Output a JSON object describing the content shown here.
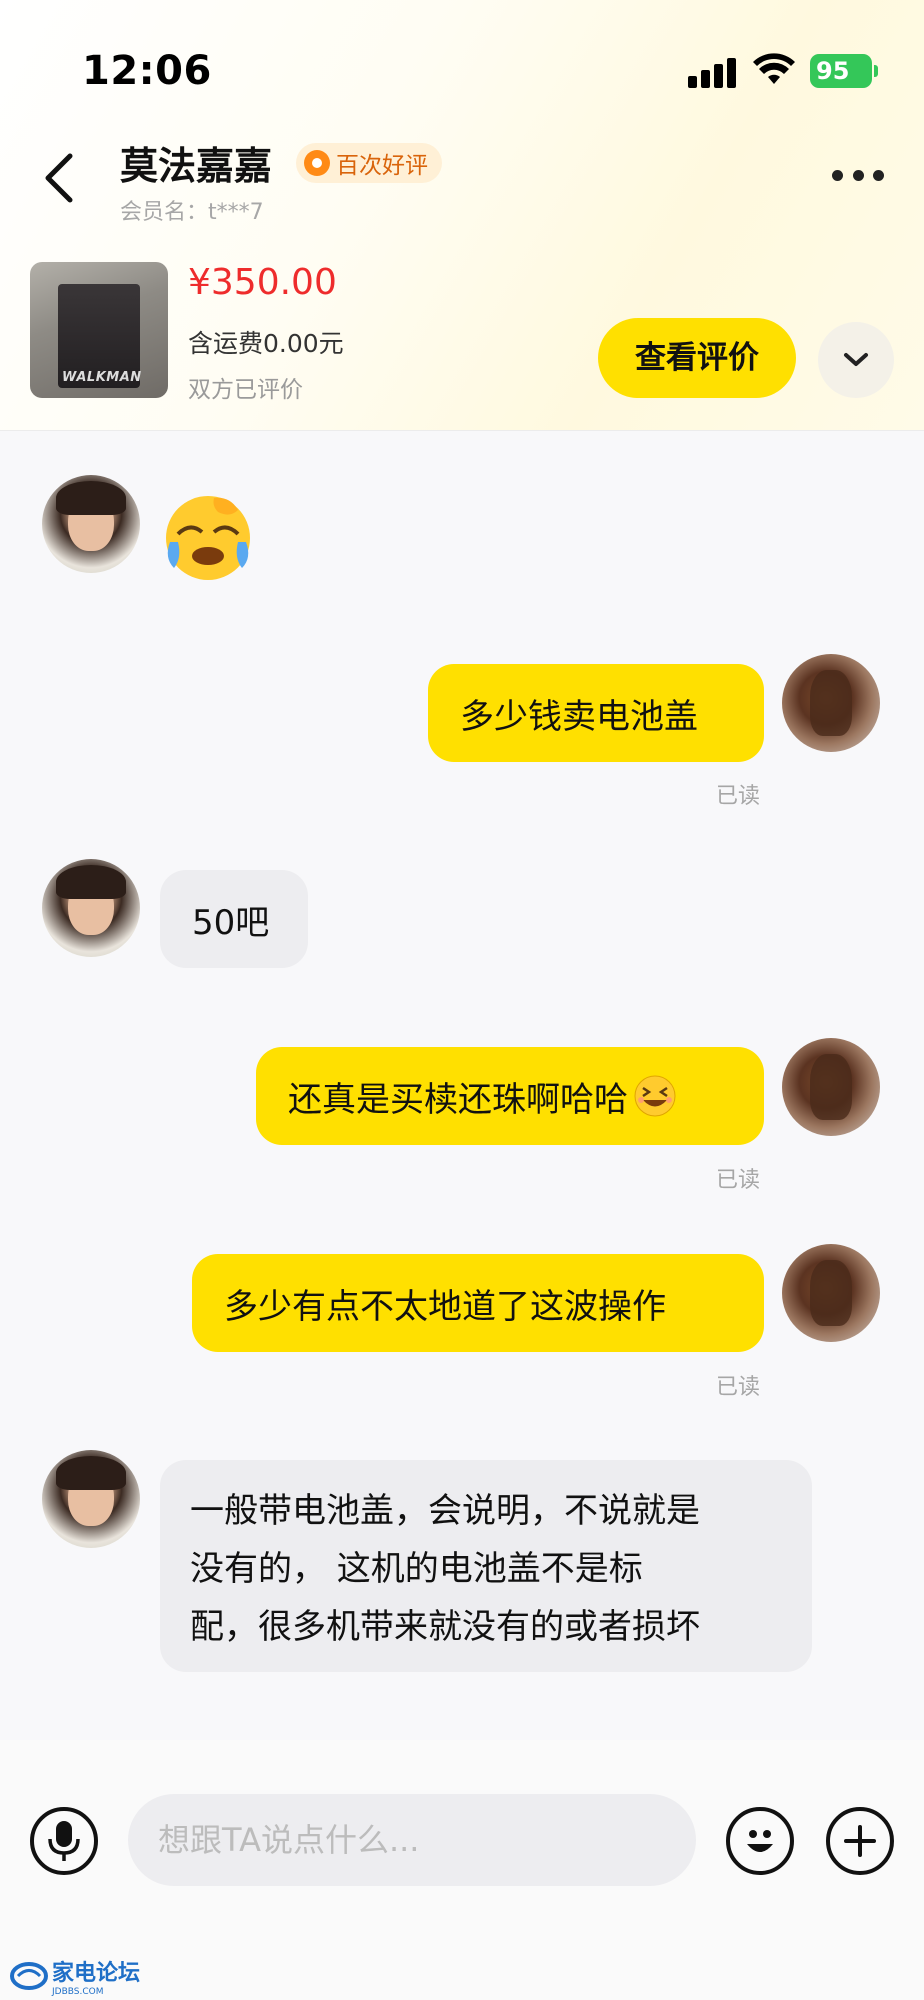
{
  "status_bar": {
    "time": "12:06",
    "battery": "95"
  },
  "nav": {
    "nickname": "莫法嘉嘉",
    "badge": "百次好评",
    "member_id": "会员名：t***7"
  },
  "product": {
    "price": "¥350.00",
    "shipping": "含运费0.00元",
    "status": "双方已评价",
    "review_button": "查看评价",
    "image_brand_text": "WALKMAN"
  },
  "messages": [
    {
      "from": "her",
      "type": "emoji",
      "emoji": "crying-laughing-emoji"
    },
    {
      "from": "me",
      "text": "多少钱卖电池盖",
      "read": "已读"
    },
    {
      "from": "her",
      "text": "50吧"
    },
    {
      "from": "me",
      "text": "还真是买椟还珠啊哈哈",
      "emoji": "grinning-squint-emoji",
      "read": "已读"
    },
    {
      "from": "me",
      "text": "多少有点不太地道了这波操作",
      "read": "已读"
    },
    {
      "from": "her",
      "lines": [
        "一般带电池盖，会说明，不说就是",
        "没有的， 这机的电池盖不是标",
        "配，很多机带来就没有的或者损坏"
      ]
    }
  ],
  "input": {
    "placeholder": "想跟TA说点什么..."
  },
  "watermark": {
    "text": "家电论坛",
    "sub": "JDBBS.COM"
  },
  "colors": {
    "accent_yellow": "#ffe000",
    "price_red": "#ee2c2c",
    "badge_orange": "#ff8a15",
    "battery_green": "#34c759"
  }
}
